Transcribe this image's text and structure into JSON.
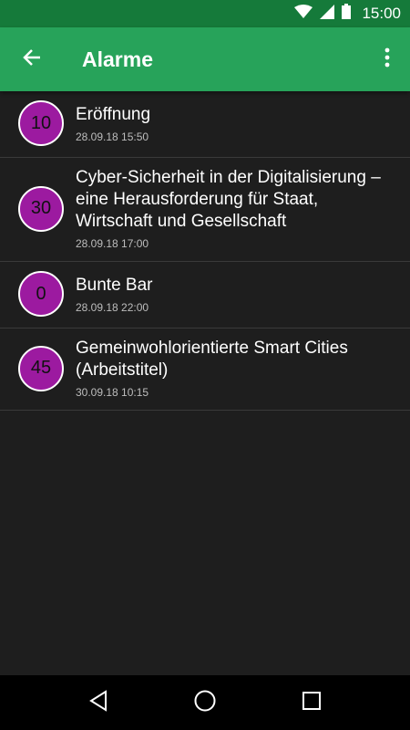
{
  "status_bar": {
    "time": "15:00",
    "icons": [
      "wifi-icon",
      "signal-icon",
      "battery-icon"
    ]
  },
  "app_bar": {
    "title": "Alarme",
    "back_icon": "arrow-left-icon",
    "menu_icon": "more-vert-icon",
    "color": "#27a35a"
  },
  "alarms": [
    {
      "badge": "10",
      "title": "Eröffnung",
      "date": "28.09.18 15:50"
    },
    {
      "badge": "30",
      "title": "Cyber-Sicherheit in der Digitalisierung – eine Herausforderung für  Staat, Wirtschaft und Gesellschaft",
      "date": "28.09.18 17:00"
    },
    {
      "badge": "0",
      "title": "Bunte Bar",
      "date": "28.09.18 22:00"
    },
    {
      "badge": "45",
      "title": "Gemeinwohlorientierte Smart Cities (Arbeitstitel)",
      "date": "30.09.18 10:15"
    }
  ],
  "nav_bar": {
    "icons": [
      "back-triangle-icon",
      "home-circle-icon",
      "recents-square-icon"
    ]
  },
  "colors": {
    "status_bar": "#157a3a",
    "badge": "#9c1aa0",
    "background": "#1e1e1e"
  }
}
